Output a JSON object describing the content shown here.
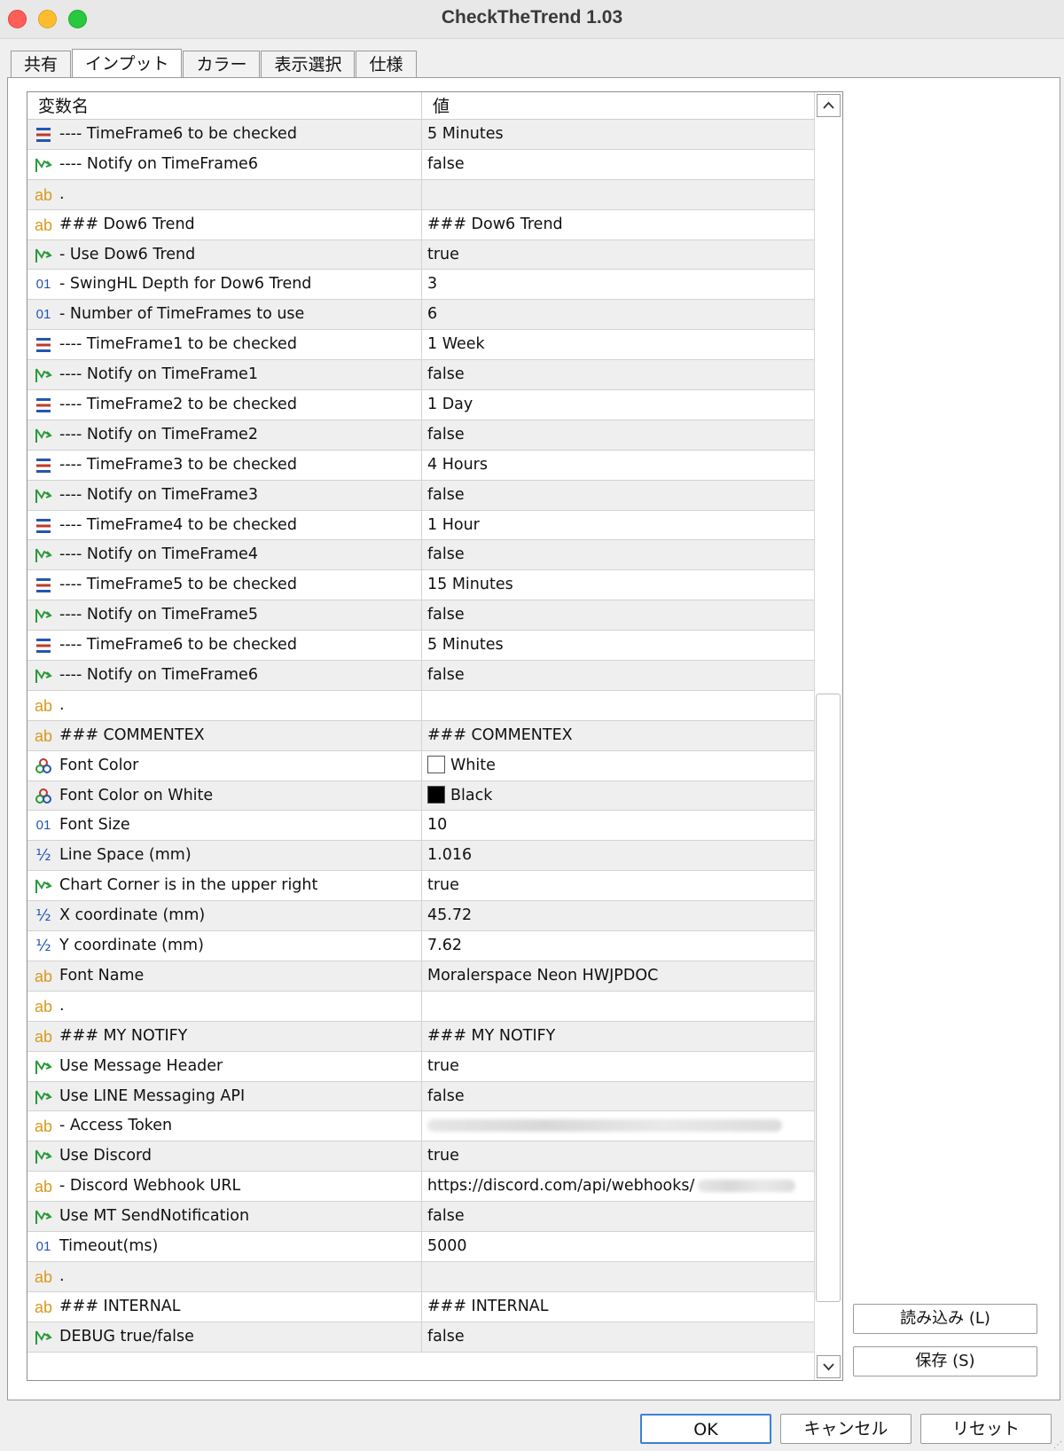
{
  "window": {
    "title": "CheckTheTrend 1.03"
  },
  "tabs": [
    {
      "label": "共有",
      "active": false
    },
    {
      "label": "インプット",
      "active": true
    },
    {
      "label": "カラー",
      "active": false
    },
    {
      "label": "表示選択",
      "active": false
    },
    {
      "label": "仕様",
      "active": false
    }
  ],
  "grid": {
    "header": {
      "name": "変数名",
      "value": "値"
    },
    "rows": [
      {
        "icon": "list",
        "name": "---- TimeFrame6 to be checked",
        "value": "5 Minutes"
      },
      {
        "icon": "bool",
        "name": "---- Notify on TimeFrame6",
        "value": "false"
      },
      {
        "icon": "ab",
        "name": ".",
        "value": ""
      },
      {
        "icon": "ab",
        "name": "### Dow6 Trend",
        "value": "### Dow6 Trend"
      },
      {
        "icon": "bool",
        "name": "- Use Dow6 Trend",
        "value": "true"
      },
      {
        "icon": "num",
        "name": "- SwingHL Depth for Dow6 Trend",
        "value": "3"
      },
      {
        "icon": "num",
        "name": "- Number of TimeFrames to use",
        "value": "6"
      },
      {
        "icon": "list",
        "name": "---- TimeFrame1 to be checked",
        "value": "1 Week"
      },
      {
        "icon": "bool",
        "name": "---- Notify on TimeFrame1",
        "value": "false"
      },
      {
        "icon": "list",
        "name": "---- TimeFrame2 to be checked",
        "value": "1 Day"
      },
      {
        "icon": "bool",
        "name": "---- Notify on TimeFrame2",
        "value": "false"
      },
      {
        "icon": "list",
        "name": "---- TimeFrame3 to be checked",
        "value": "4 Hours"
      },
      {
        "icon": "bool",
        "name": "---- Notify on TimeFrame3",
        "value": "false"
      },
      {
        "icon": "list",
        "name": "---- TimeFrame4 to be checked",
        "value": "1 Hour"
      },
      {
        "icon": "bool",
        "name": "---- Notify on TimeFrame4",
        "value": "false"
      },
      {
        "icon": "list",
        "name": "---- TimeFrame5 to be checked",
        "value": "15 Minutes"
      },
      {
        "icon": "bool",
        "name": "---- Notify on TimeFrame5",
        "value": "false"
      },
      {
        "icon": "list",
        "name": "---- TimeFrame6 to be checked",
        "value": "5 Minutes"
      },
      {
        "icon": "bool",
        "name": "---- Notify on TimeFrame6",
        "value": "false"
      },
      {
        "icon": "ab",
        "name": ".",
        "value": ""
      },
      {
        "icon": "ab",
        "name": "### COMMENTEX",
        "value": "### COMMENTEX"
      },
      {
        "icon": "color",
        "name": "Font Color",
        "value": "White",
        "swatch": "#ffffff"
      },
      {
        "icon": "color",
        "name": "Font Color on White",
        "value": "Black",
        "swatch": "#000000"
      },
      {
        "icon": "num",
        "name": "Font Size",
        "value": "10"
      },
      {
        "icon": "half",
        "name": "Line Space (mm)",
        "value": "1.016"
      },
      {
        "icon": "bool",
        "name": "Chart Corner is in the upper right",
        "value": "true"
      },
      {
        "icon": "half",
        "name": "X coordinate (mm)",
        "value": "45.72"
      },
      {
        "icon": "half",
        "name": "Y coordinate (mm)",
        "value": "7.62"
      },
      {
        "icon": "ab",
        "name": "Font Name",
        "value": "Moralerspace Neon HWJPDOC"
      },
      {
        "icon": "ab",
        "name": ".",
        "value": ""
      },
      {
        "icon": "ab",
        "name": "### MY NOTIFY",
        "value": "### MY NOTIFY"
      },
      {
        "icon": "bool",
        "name": "Use Message Header",
        "value": "true"
      },
      {
        "icon": "bool",
        "name": "Use LINE Messaging API",
        "value": "false"
      },
      {
        "icon": "ab",
        "name": "- Access Token",
        "value": "",
        "redacted": true
      },
      {
        "icon": "bool",
        "name": "Use Discord",
        "value": "true"
      },
      {
        "icon": "ab",
        "name": "- Discord Webhook URL",
        "value": "https://discord.com/api/webhooks/",
        "redacted_tail": true
      },
      {
        "icon": "bool",
        "name": "Use MT SendNotification",
        "value": "false"
      },
      {
        "icon": "num",
        "name": "Timeout(ms)",
        "value": "5000"
      },
      {
        "icon": "ab",
        "name": ".",
        "value": ""
      },
      {
        "icon": "ab",
        "name": "### INTERNAL",
        "value": "### INTERNAL"
      },
      {
        "icon": "bool",
        "name": "DEBUG true/false",
        "value": "false"
      }
    ]
  },
  "icon_glyphs": {
    "ab": "ab",
    "num": "01",
    "half": "½"
  },
  "side_buttons": {
    "load": "読み込み (L)",
    "save": "保存 (S)"
  },
  "bottom_buttons": {
    "ok": "OK",
    "cancel": "キャンセル",
    "reset": "リセット"
  },
  "colors": {
    "accent": "#3b82d6",
    "bool_icon": "#2a9a3a",
    "list_icon": "#2456b0",
    "ab_icon": "#d79a1c"
  }
}
